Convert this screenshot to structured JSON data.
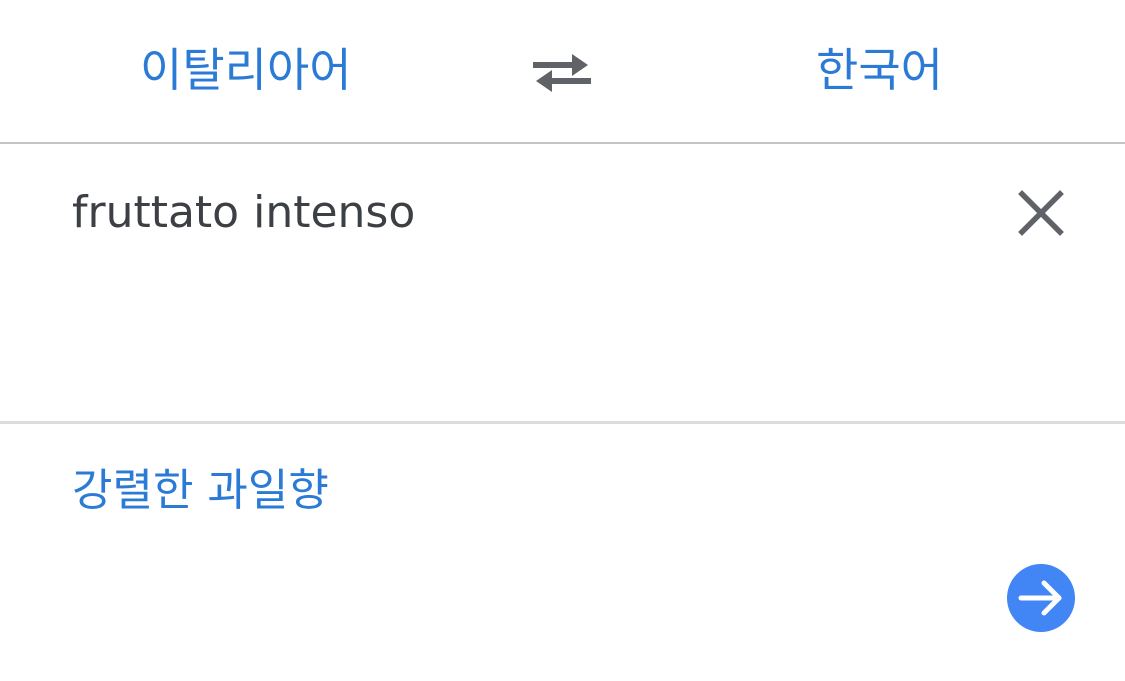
{
  "languages": {
    "source_label": "이탈리아어",
    "target_label": "한국어",
    "swap_icon": "swap-arrows-icon"
  },
  "input": {
    "text": "fruttato intenso",
    "clear_icon": "close-icon"
  },
  "result": {
    "text": "강렬한 과일향",
    "go_icon": "arrow-right-icon"
  },
  "colors": {
    "accent": "#2b7bd6",
    "button_blue": "#4285f4",
    "text_dark": "#3c3f43",
    "icon_gray": "#5f6368",
    "divider": "#c4c4c4"
  }
}
